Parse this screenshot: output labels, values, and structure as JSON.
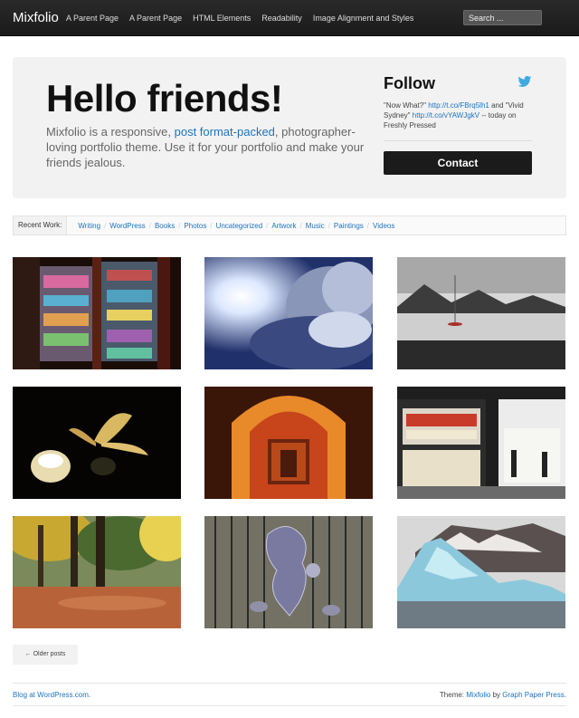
{
  "header": {
    "site_title": "Mixfolio",
    "nav": [
      "A Parent Page",
      "A Parent Page",
      "HTML Elements",
      "Readability",
      "Image Alignment and Styles"
    ],
    "search_placeholder": "Search ..."
  },
  "hero": {
    "title": "Hello friends!",
    "intro_before": "Mixfolio is a responsive, ",
    "intro_link": "post format-packed",
    "intro_after": ", photographer-loving portfolio theme. Use it for your portfolio and make your friends jealous."
  },
  "follow": {
    "title": "Follow",
    "icon": "twitter-bird-icon",
    "tweet_part1": "\"Now What?\" ",
    "tweet_link1": "http://t.co/FBrq5lh1",
    "tweet_part2": " and \"Vivid Sydney\" ",
    "tweet_link2": "http://t.co/vYAWJgkV",
    "tweet_part3": " -- today on Freshly Pressed",
    "contact_label": "Contact"
  },
  "recent_work": {
    "label": "Recent Work:",
    "categories": [
      "Writing",
      "WordPress",
      "Books",
      "Photos",
      "Uncategorized",
      "Artwork",
      "Music",
      "Paintings",
      "Videos"
    ]
  },
  "gallery": [
    "shop-window-photo",
    "sun-clouds-photo",
    "lake-boat-photo",
    "candle-lily-photo",
    "glowing-arch-photo",
    "caffe-storefront-photo",
    "autumn-park-photo",
    "lion-gate-photo",
    "iceberg-photo"
  ],
  "pagination": {
    "older_label": "← Older posts"
  },
  "footer": {
    "left_link": "Blog at WordPress.com.",
    "right_prefix": "Theme: ",
    "right_theme": "Mixfolio",
    "right_mid": " by ",
    "right_author": "Graph Paper Press",
    "right_suffix": "."
  },
  "colors": {
    "link": "#1e73be",
    "topbar": "#1f1f1f",
    "button": "#1b1b1b"
  }
}
